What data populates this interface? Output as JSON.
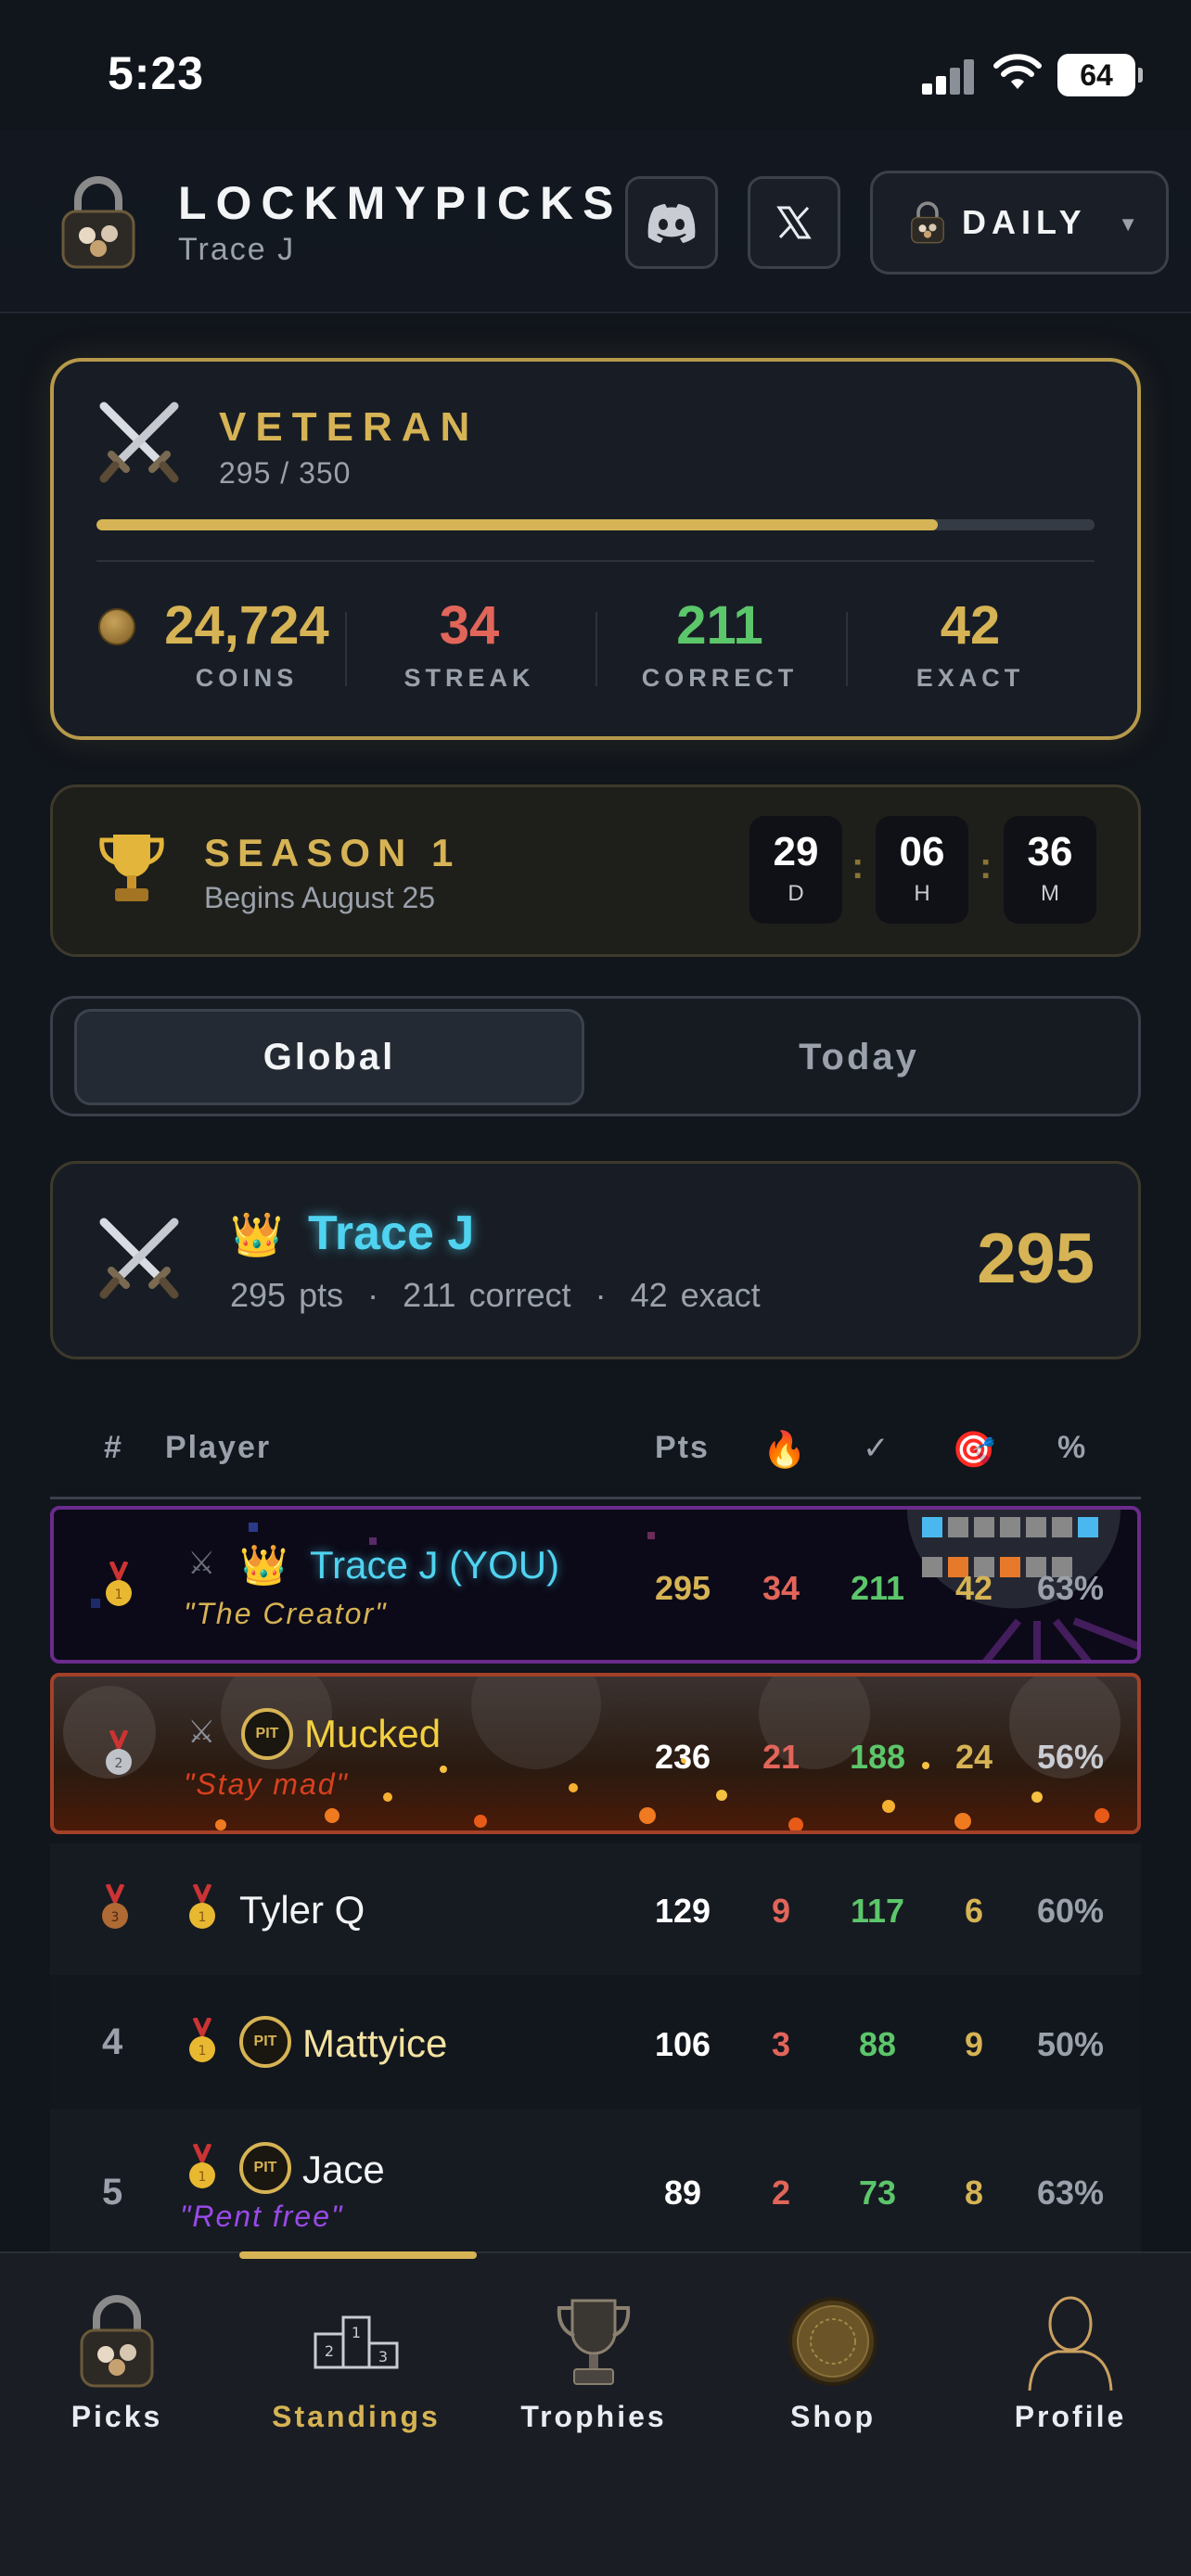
{
  "status_bar": {
    "time": "5:23",
    "battery": "64"
  },
  "header": {
    "app_name": "LOCKMYPICKS",
    "username": "Trace J",
    "mode_label": "DAILY"
  },
  "rank": {
    "title": "VETERAN",
    "progress_text": "295 / 350",
    "progress_fraction": 0.843,
    "stats": [
      {
        "value": "24,724",
        "label": "COINS",
        "color": "#d6b354"
      },
      {
        "value": "34",
        "label": "STREAK",
        "color": "#e2655a"
      },
      {
        "value": "211",
        "label": "CORRECT",
        "color": "#5cc66a"
      },
      {
        "value": "42",
        "label": "EXACT",
        "color": "#d6b354"
      }
    ]
  },
  "season": {
    "title": "SEASON 1",
    "subtitle": "Begins August 25",
    "countdown": [
      {
        "value": "29",
        "unit": "D"
      },
      {
        "value": "06",
        "unit": "H"
      },
      {
        "value": "36",
        "unit": "M"
      }
    ]
  },
  "tabs": {
    "global": "Global",
    "today": "Today"
  },
  "my_card": {
    "name": "Trace J",
    "pts": "295 pts",
    "correct": "211 correct",
    "exact": "42 exact",
    "separator": "·",
    "points": "295"
  },
  "table": {
    "headers": {
      "rank": "#",
      "player": "Player",
      "pts": "Pts",
      "pct": "%"
    },
    "rows": [
      {
        "rank": "1",
        "name": "Trace J (YOU)",
        "quote": "\"The Creator\"",
        "pts": "295",
        "streak": "34",
        "correct": "211",
        "exact": "42",
        "pct": "63%"
      },
      {
        "rank": "2",
        "name": "Mucked",
        "quote": "\"Stay mad\"",
        "pts": "236",
        "streak": "21",
        "correct": "188",
        "exact": "24",
        "pct": "56%"
      },
      {
        "rank": "3",
        "name": "Tyler Q",
        "quote": "",
        "pts": "129",
        "streak": "9",
        "correct": "117",
        "exact": "6",
        "pct": "60%"
      },
      {
        "rank": "4",
        "name": "Mattyice",
        "quote": "",
        "pts": "106",
        "streak": "3",
        "correct": "88",
        "exact": "9",
        "pct": "50%"
      },
      {
        "rank": "5",
        "name": "Jace",
        "quote": "\"Rent free\"",
        "pts": "89",
        "streak": "2",
        "correct": "73",
        "exact": "8",
        "pct": "63%"
      }
    ]
  },
  "pit_badge": "PIT",
  "nav": [
    {
      "label": "Picks",
      "icon": "lock-icon"
    },
    {
      "label": "Standings",
      "icon": "podium-icon",
      "active": true
    },
    {
      "label": "Trophies",
      "icon": "trophy-icon"
    },
    {
      "label": "Shop",
      "icon": "coin-icon"
    },
    {
      "label": "Profile",
      "icon": "person-icon"
    }
  ]
}
